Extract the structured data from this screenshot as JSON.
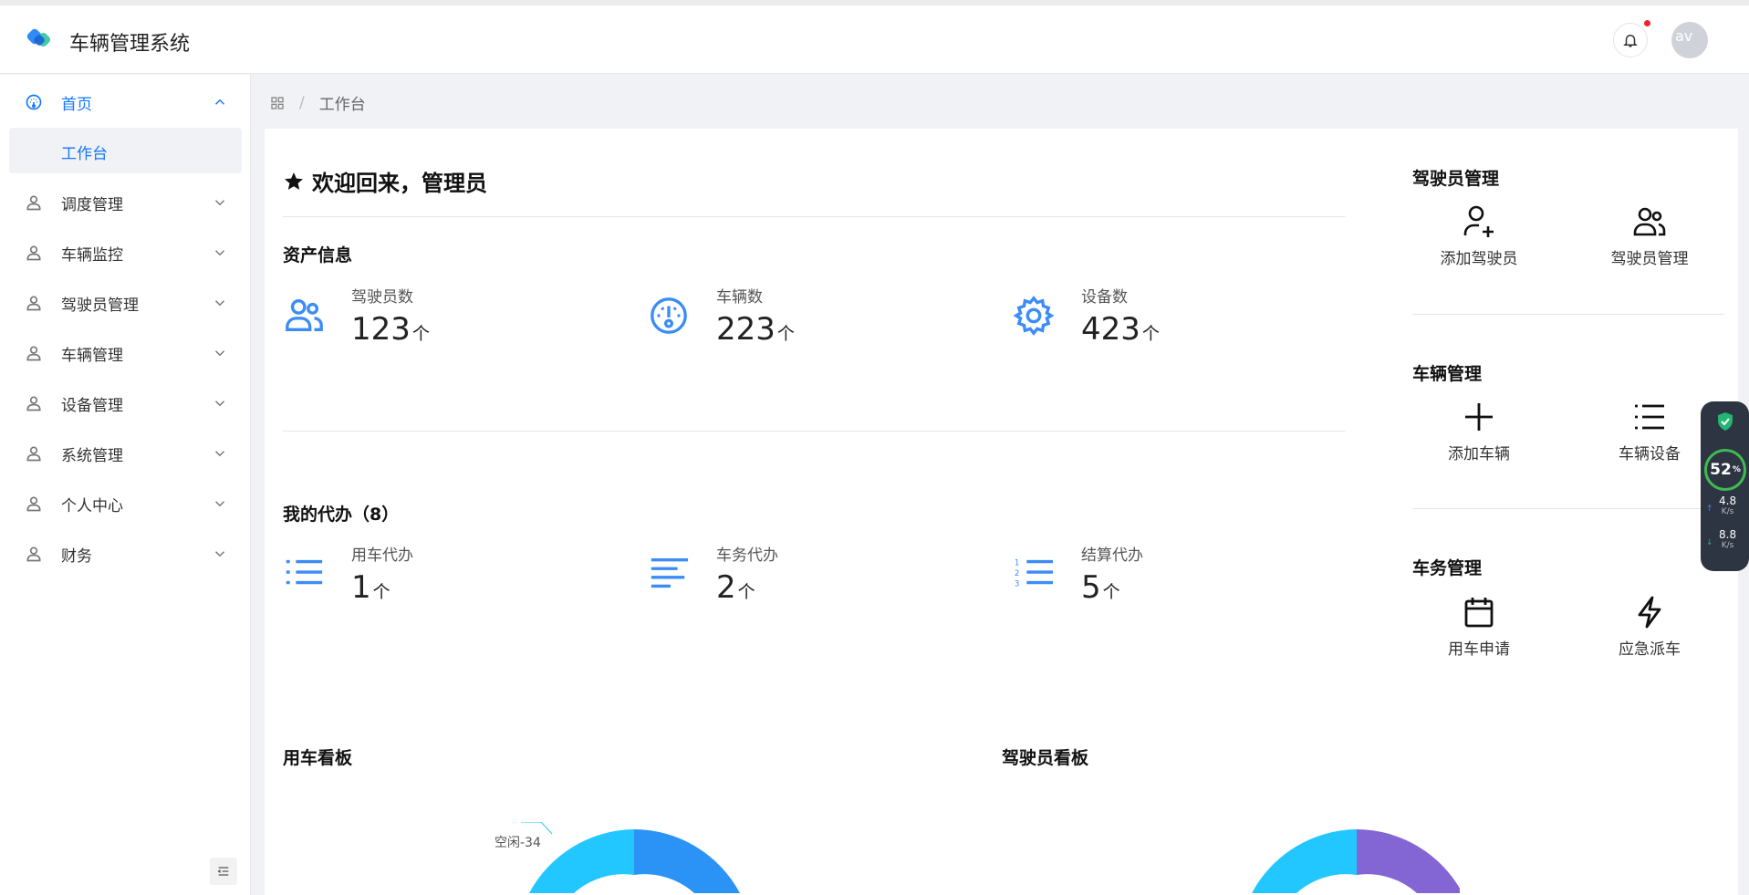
{
  "header": {
    "app_title": "车辆管理系统",
    "avatar_alt": "av"
  },
  "sidebar": {
    "items": [
      {
        "label": "首页",
        "icon": "dashboard-icon"
      },
      {
        "label": "调度管理",
        "icon": "user-icon"
      },
      {
        "label": "车辆监控",
        "icon": "user-icon"
      },
      {
        "label": "驾驶员管理",
        "icon": "user-icon"
      },
      {
        "label": "车辆管理",
        "icon": "user-icon"
      },
      {
        "label": "设备管理",
        "icon": "user-icon"
      },
      {
        "label": "系统管理",
        "icon": "user-icon"
      },
      {
        "label": "个人中心",
        "icon": "user-icon"
      },
      {
        "label": "财务",
        "icon": "user-icon"
      }
    ],
    "submenu_label": "工作台"
  },
  "breadcrumb": {
    "sep": "/",
    "current": "工作台"
  },
  "welcome": "欢迎回来，管理员",
  "assets": {
    "title": "资产信息",
    "stats": [
      {
        "label": "驾驶员数",
        "value": "123",
        "unit": "个"
      },
      {
        "label": "车辆数",
        "value": "223",
        "unit": "个"
      },
      {
        "label": "设备数",
        "value": "423",
        "unit": "个"
      }
    ]
  },
  "todo": {
    "title": "我的代办（8）",
    "stats": [
      {
        "label": "用车代办",
        "value": "1",
        "unit": "个"
      },
      {
        "label": "车务代办",
        "value": "2",
        "unit": "个"
      },
      {
        "label": "结算代办",
        "value": "5",
        "unit": "个"
      }
    ]
  },
  "quick": {
    "driver": {
      "title": "驾驶员管理",
      "add": "添加驾驶员",
      "manage": "驾驶员管理"
    },
    "vehicle": {
      "title": "车辆管理",
      "add": "添加车辆",
      "devices": "车辆设备"
    },
    "affairs": {
      "title": "车务管理",
      "apply": "用车申请",
      "emergency": "应急派车"
    }
  },
  "boards": {
    "vehicle_board": "用车看板",
    "driver_board": "驾驶员看板",
    "idle_label": "空闲-34"
  },
  "net_widget": {
    "percent": "52",
    "percent_unit": "%",
    "up": "4.8",
    "down": "8.8",
    "speed_unit": "K/s"
  },
  "colors": {
    "accent": "#1677ff",
    "icon_blue": "#3b8cf6",
    "donut_blue": "#2b93f5",
    "donut_cyan": "#23c7ff",
    "donut_purple": "#8465d4"
  }
}
